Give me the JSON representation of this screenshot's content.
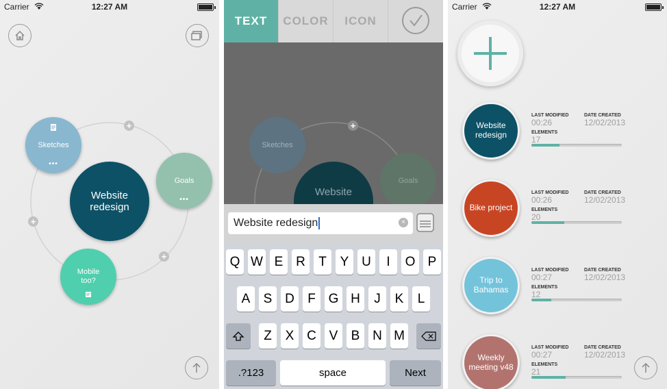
{
  "status": {
    "carrier": "Carrier",
    "time": "12:27 AM"
  },
  "map": {
    "bubbles": {
      "center": "Website redesign",
      "sketches": "Sketches",
      "goals": "Goals",
      "mobile": "Mobile too?"
    },
    "dots": "•••"
  },
  "editor": {
    "tabs": {
      "text": "TEXT",
      "color": "COLOR",
      "icon": "ICON"
    },
    "input_value": "Website redesign",
    "clear_glyph": "×",
    "bg_bubbles": {
      "center": "Website",
      "sketches": "Sketches",
      "goals": "Goals"
    },
    "keyboard": {
      "row1": [
        "Q",
        "W",
        "E",
        "R",
        "T",
        "Y",
        "U",
        "I",
        "O",
        "P"
      ],
      "row2": [
        "A",
        "S",
        "D",
        "F",
        "G",
        "H",
        "J",
        "K",
        "L"
      ],
      "row3": [
        "Z",
        "X",
        "C",
        "V",
        "B",
        "N",
        "M"
      ],
      "numbers": ".?123",
      "space": "space",
      "next": "Next"
    }
  },
  "projects": {
    "label_last_modified": "LAST MODIFIED",
    "label_date_created": "DATE CREATED",
    "label_elements": "ELEMENTS",
    "items": [
      {
        "name_line1": "Website",
        "name_line2": "redesign",
        "last_modified": "00:26",
        "date_created": "12/02/2013",
        "elements": "17",
        "color": "#0d5166",
        "fill": 0.31
      },
      {
        "name_line1": "Bike project",
        "name_line2": "",
        "last_modified": "00:26",
        "date_created": "12/02/2013",
        "elements": "20",
        "color": "#c84524",
        "fill": 0.36
      },
      {
        "name_line1": "Trip to",
        "name_line2": "Bahamas",
        "last_modified": "00:27",
        "date_created": "12/02/2013",
        "elements": "12",
        "color": "#73c3db",
        "fill": 0.22
      },
      {
        "name_line1": "Weekly",
        "name_line2": "meeting v48",
        "last_modified": "00:27",
        "date_created": "12/02/2013",
        "elements": "21",
        "color": "#b2736f",
        "fill": 0.38
      }
    ]
  }
}
